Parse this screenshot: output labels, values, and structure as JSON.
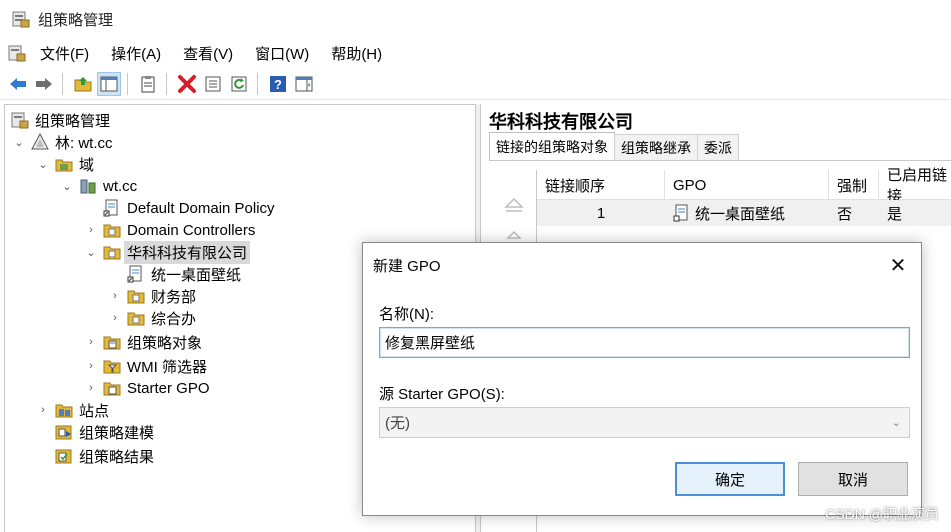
{
  "window": {
    "title": "组策略管理"
  },
  "menubar": {
    "items": [
      "文件(F)",
      "操作(A)",
      "查看(V)",
      "窗口(W)",
      "帮助(H)"
    ]
  },
  "toolbar": {
    "icons": [
      "back-arrow-icon",
      "forward-arrow-icon",
      "up-folder-icon",
      "show-tree-icon",
      "clipboard-icon",
      "delete-icon",
      "properties-icon",
      "refresh-icon",
      "help-icon",
      "action-pane-icon"
    ]
  },
  "tree": {
    "root": "组策略管理",
    "forest": "林: wt.cc",
    "domains": "域",
    "domain": "wt.cc",
    "default_policy": "Default Domain Policy",
    "domain_controllers": "Domain Controllers",
    "ou_selected": "华科科技有限公司",
    "gpo_link": "统一桌面壁纸",
    "ou_finance": "财务部",
    "ou_general": "综合办",
    "gpo_objects": "组策略对象",
    "wmi_filters": "WMI 筛选器",
    "starter_gpo": "Starter GPO",
    "sites": "站点",
    "modeling": "组策略建模",
    "results": "组策略结果"
  },
  "right_pane": {
    "title": "华科科技有限公司",
    "tabs": [
      "链接的组策略对象",
      "组策略继承",
      "委派"
    ],
    "columns": [
      "链接顺序",
      "GPO",
      "强制",
      "已启用链接"
    ],
    "rows": [
      {
        "order": "1",
        "gpo": "统一桌面壁纸",
        "enforced": "否",
        "enabled": "是"
      }
    ]
  },
  "dialog": {
    "title": "新建 GPO",
    "name_label": "名称(N):",
    "name_value": "修复黑屏壁纸",
    "starter_label": "源 Starter GPO(S):",
    "starter_value": "(无)",
    "ok_label": "确定",
    "cancel_label": "取消"
  },
  "watermark": "CSDN @职业演员"
}
